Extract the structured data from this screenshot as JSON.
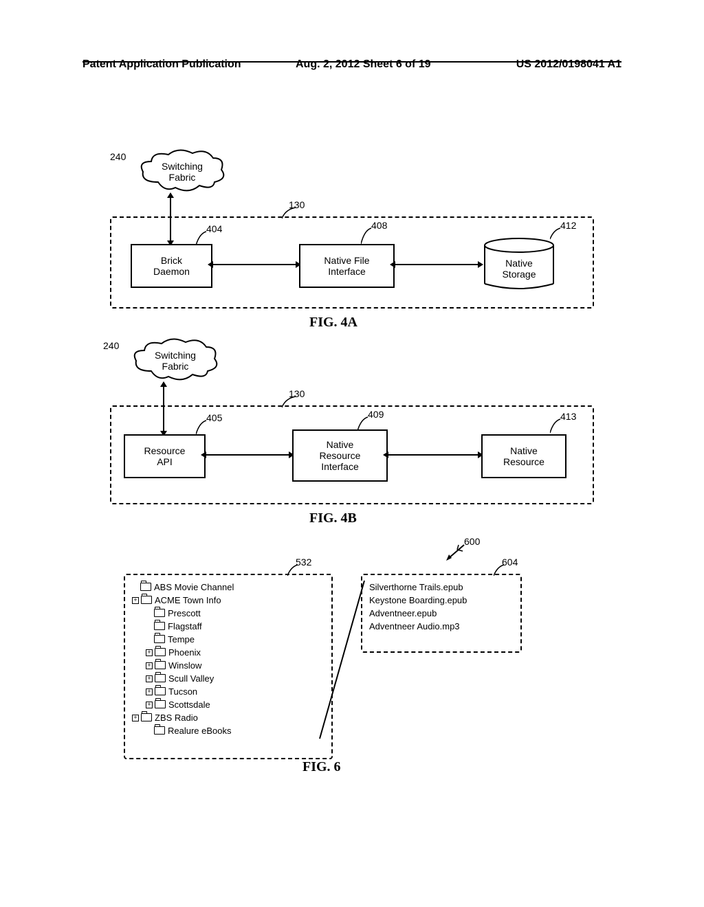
{
  "header": {
    "left": "Patent Application Publication",
    "center": "Aug. 2, 2012  Sheet 6 of 19",
    "right": "US 2012/0198041 A1"
  },
  "fig4a": {
    "caption": "FIG. 4A",
    "cloud": {
      "ref": "240",
      "text": "Switching\nFabric"
    },
    "container_ref": "130",
    "block1": {
      "ref": "404",
      "text": "Brick\nDaemon"
    },
    "block2": {
      "ref": "408",
      "text": "Native File\nInterface"
    },
    "storage": {
      "ref": "412",
      "text": "Native\nStorage"
    }
  },
  "fig4b": {
    "caption": "FIG. 4B",
    "cloud": {
      "ref": "240",
      "text": "Switching\nFabric"
    },
    "container_ref": "130",
    "block1": {
      "ref": "405",
      "text": "Resource\nAPI"
    },
    "block2": {
      "ref": "409",
      "text": "Native\nResource\nInterface"
    },
    "block3": {
      "ref": "413",
      "text": "Native\nResource"
    }
  },
  "fig6": {
    "caption": "FIG. 6",
    "left_panel_ref": "532",
    "arrow_ref": "600",
    "right_panel_ref": "604",
    "tree": [
      {
        "indent": 0,
        "expand": "",
        "name": "ABS Movie Channel"
      },
      {
        "indent": 0,
        "expand": "plus",
        "name": "ACME Town Info"
      },
      {
        "indent": 1,
        "expand": "",
        "name": "Prescott"
      },
      {
        "indent": 1,
        "expand": "",
        "name": "Flagstaff"
      },
      {
        "indent": 1,
        "expand": "",
        "name": "Tempe"
      },
      {
        "indent": 1,
        "expand": "plus",
        "name": "Phoenix"
      },
      {
        "indent": 1,
        "expand": "plus",
        "name": "Winslow"
      },
      {
        "indent": 1,
        "expand": "plus",
        "name": "Scull Valley"
      },
      {
        "indent": 1,
        "expand": "plus",
        "name": "Tucson"
      },
      {
        "indent": 1,
        "expand": "plus",
        "name": "Scottsdale"
      },
      {
        "indent": 0,
        "expand": "plus",
        "name": "ZBS Radio"
      },
      {
        "indent": 1,
        "expand": "",
        "name": "Realure eBooks"
      }
    ],
    "files": [
      "Silverthorne Trails.epub",
      "Keystone Boarding.epub",
      "Adventneer.epub",
      "Adventneer Audio.mp3"
    ]
  }
}
